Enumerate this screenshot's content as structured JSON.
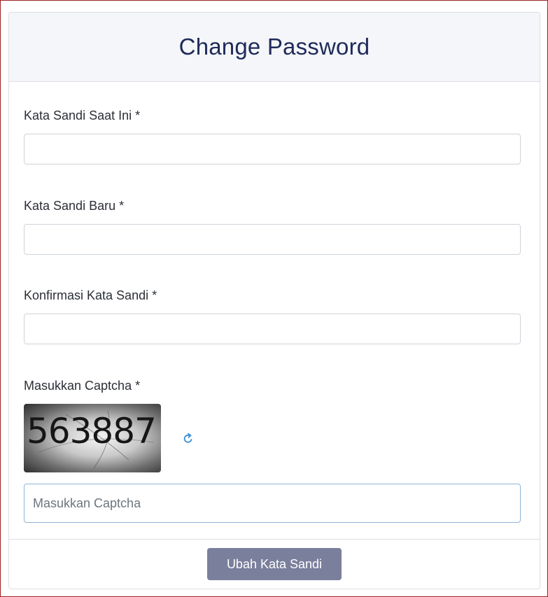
{
  "header": {
    "title": "Change Password"
  },
  "form": {
    "current_password_label": "Kata Sandi Saat Ini *",
    "current_password_value": "",
    "new_password_label": "Kata Sandi Baru *",
    "new_password_value": "",
    "confirm_password_label": "Konfirmasi Kata Sandi *",
    "confirm_password_value": "",
    "captcha_label": "Masukkan Captcha *",
    "captcha_text": "563887",
    "captcha_placeholder": "Masukkan Captcha",
    "captcha_value": ""
  },
  "footer": {
    "submit_label": "Ubah Kata Sandi"
  },
  "colors": {
    "title": "#1f2a5a",
    "button": "#7a7f9c",
    "refresh_icon": "#3b8fd6",
    "frame_border": "#9b2226"
  },
  "icons": {
    "refresh": "refresh-icon"
  }
}
